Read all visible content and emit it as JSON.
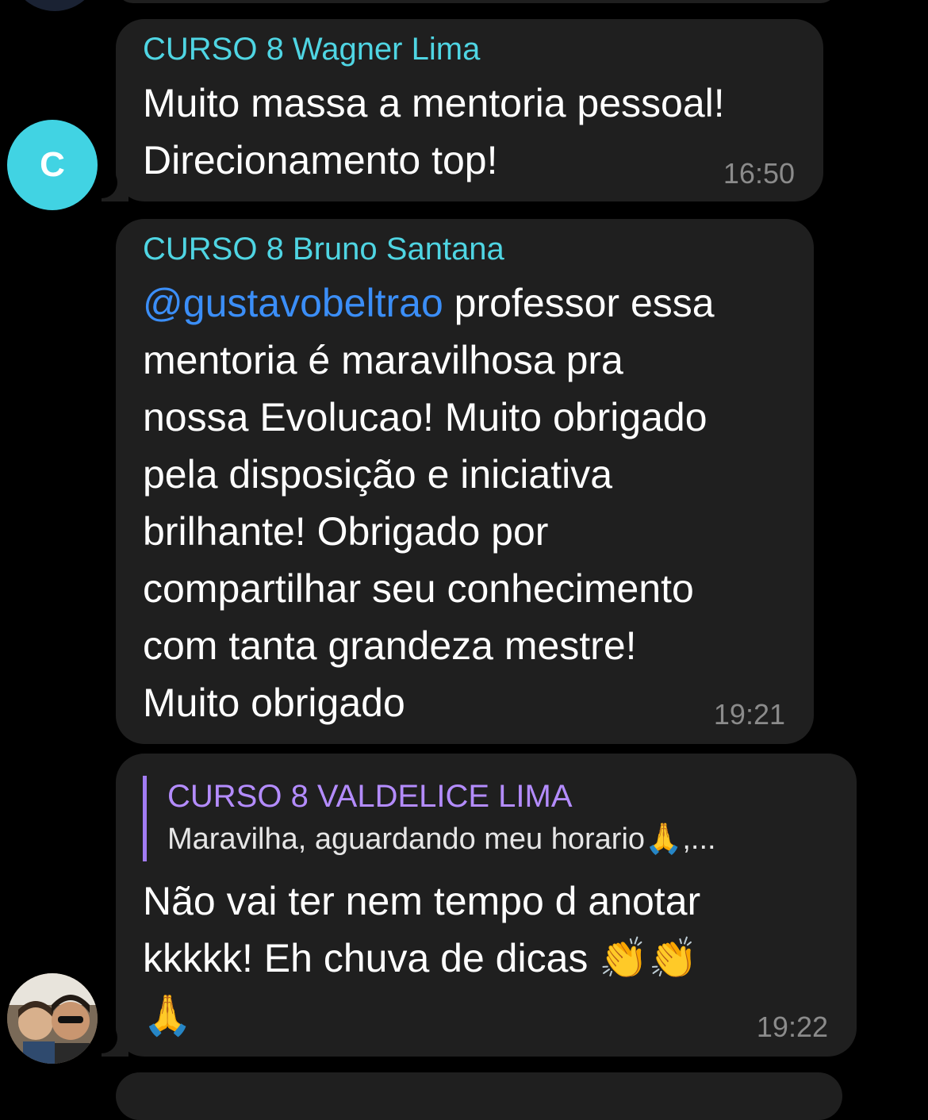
{
  "messages": [
    {
      "sender": "CURSO 8 Wagner Lima",
      "text": "Muito massa a mentoria pessoal!\nDirecionamento top!",
      "time": "16:50",
      "avatar_letter": "C"
    },
    {
      "sender": "CURSO 8 Bruno Santana",
      "mention": "@gustavobeltrao",
      "text": " professor essa\nmentoria é maravilhosa pra\nnossa Evolucao! Muito obrigado\npela disposição e iniciativa\nbrilhante! Obrigado por\ncompartilhar seu conhecimento\ncom tanta grandeza mestre!\nMuito obrigado",
      "time": "19:21"
    },
    {
      "reply": {
        "name": "CURSO 8 VALDELICE LIMA",
        "text": "Maravilha, aguardando meu horario🙏,..."
      },
      "text": "Não vai ter nem tempo d anotar\nkkkkk! Eh chuva de dicas 👏👏\n🙏",
      "time": "19:22"
    }
  ],
  "colors": {
    "background": "#000000",
    "bubble": "#1f1f1f",
    "sender": "#4fd5e3",
    "mention": "#3b8ef7",
    "reply_accent": "#a27cf4"
  },
  "icons": {
    "avatar_photo": "user-photo-avatar"
  }
}
